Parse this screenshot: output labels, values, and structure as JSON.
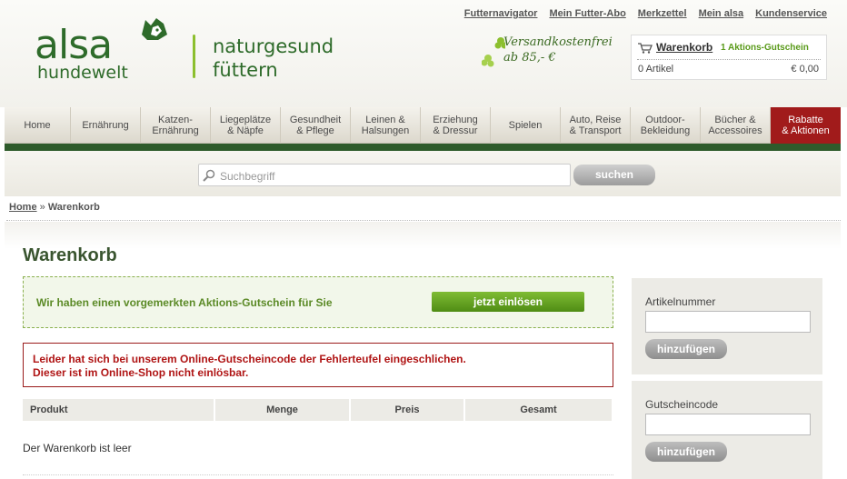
{
  "header": {
    "logo_brand": "alsa",
    "logo_sub": "hundewelt",
    "slogan_line1": "naturgesund",
    "slogan_line2": "füttern",
    "top_links": [
      "Futternavigator",
      "Mein Futter-Abo",
      "Merkzettel",
      "Mein alsa",
      "Kundenservice"
    ],
    "shipping_line1": "Versandkostenfrei",
    "shipping_line2": "ab 85,- €",
    "cart": {
      "title": "Warenkorb",
      "voucher": "1 Aktions-Gutschein",
      "count": "0 Artikel",
      "sum": "€ 0,00"
    }
  },
  "nav": [
    {
      "label1": "Home",
      "label2": ""
    },
    {
      "label1": "Ernährung",
      "label2": ""
    },
    {
      "label1": "Katzen-",
      "label2": "Ernährung"
    },
    {
      "label1": "Liegeplätze",
      "label2": "& Näpfe"
    },
    {
      "label1": "Gesundheit",
      "label2": "& Pflege"
    },
    {
      "label1": "Leinen &",
      "label2": "Halsungen"
    },
    {
      "label1": "Erziehung",
      "label2": "& Dressur"
    },
    {
      "label1": "Spielen",
      "label2": ""
    },
    {
      "label1": "Auto, Reise",
      "label2": "& Transport"
    },
    {
      "label1": "Outdoor-",
      "label2": "Bekleidung"
    },
    {
      "label1": "Bücher &",
      "label2": "Accessoires"
    },
    {
      "label1": "Rabatte",
      "label2": "& Aktionen"
    }
  ],
  "search": {
    "placeholder": "Suchbegriff",
    "button": "suchen"
  },
  "breadcrumb": {
    "home": "Home",
    "sep": "»",
    "current": "Warenkorb"
  },
  "main": {
    "title": "Warenkorb",
    "voucher_text": "Wir haben einen vorgemerkten Aktions-Gutschein für Sie",
    "voucher_button": "jetzt einlösen",
    "error_line1": "Leider hat sich bei unserem Online-Gutscheincode der Fehlerteufel eingeschlichen.",
    "error_line2": "Dieser ist im Online-Shop nicht einlösbar.",
    "table_headers": [
      "Produkt",
      "Menge",
      "Preis",
      "Gesamt"
    ],
    "empty_text": "Der Warenkorb ist leer"
  },
  "sidebar": {
    "article": {
      "label": "Artikelnummer",
      "button": "hinzufügen"
    },
    "voucher": {
      "label": "Gutscheincode",
      "button": "hinzufügen"
    }
  },
  "colors": {
    "brand_green": "#2e6b2a",
    "nav_green_bar": "#2e5b2b",
    "promo_red": "#a11b1b",
    "error_red": "#b01515",
    "voucher_green": "#5b8a26"
  }
}
